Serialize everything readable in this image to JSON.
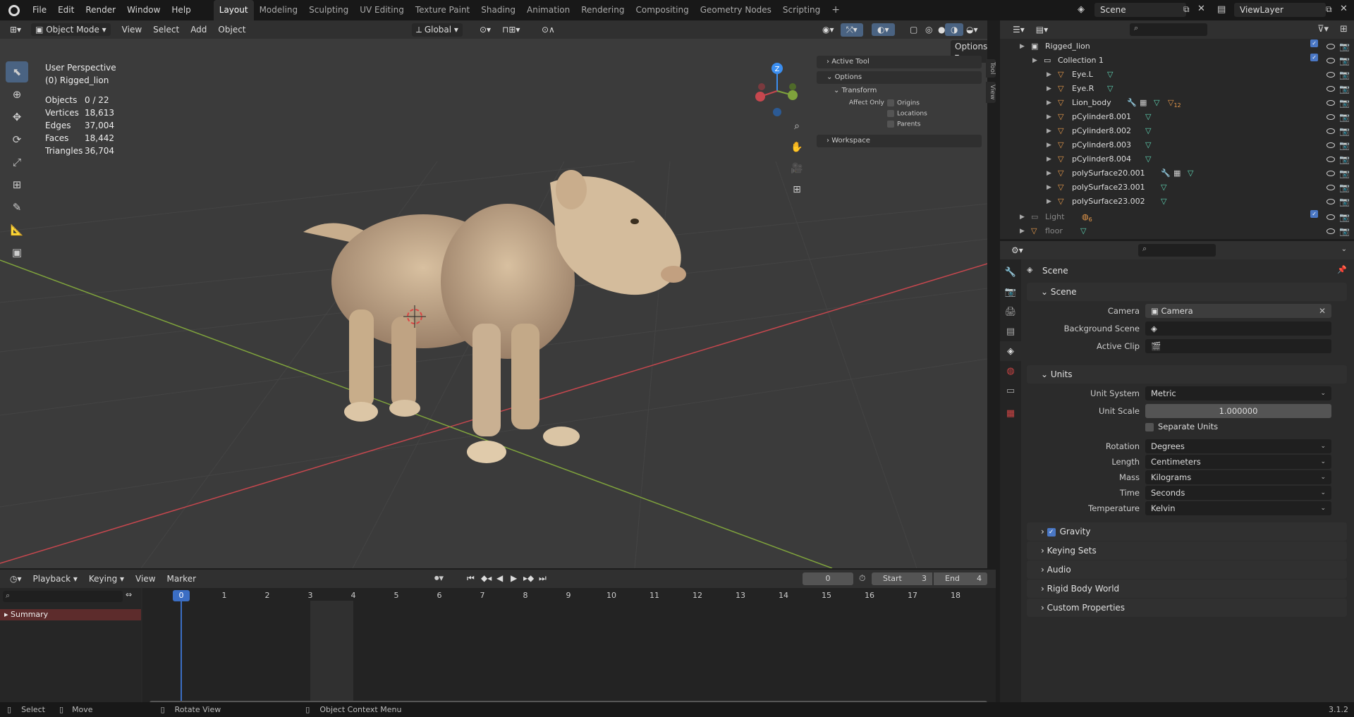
{
  "topbar": {
    "menus": [
      "File",
      "Edit",
      "Render",
      "Window",
      "Help"
    ],
    "workspaces": [
      "Layout",
      "Modeling",
      "Sculpting",
      "UV Editing",
      "Texture Paint",
      "Shading",
      "Animation",
      "Rendering",
      "Compositing",
      "Geometry Nodes",
      "Scripting"
    ],
    "active_workspace": "Layout",
    "add_tab": "+",
    "scene": "Scene",
    "view_layer": "ViewLayer"
  },
  "viewport": {
    "mode": "Object Mode",
    "menus": [
      "View",
      "Select",
      "Add",
      "Object"
    ],
    "orientation": "Global",
    "options_label": "Options",
    "view_name": "User Perspective",
    "collection_info": "(0) Rigged_lion",
    "stats": [
      {
        "k": "Objects",
        "v": "0 / 22"
      },
      {
        "k": "Vertices",
        "v": "18,613"
      },
      {
        "k": "Edges",
        "v": "37,004"
      },
      {
        "k": "Faces",
        "v": "18,442"
      },
      {
        "k": "Triangles",
        "v": "36,704"
      }
    ],
    "sidebar": {
      "active_tool": "Active Tool",
      "options": "Options",
      "transform": "Transform",
      "affect_only": "Affect Only",
      "origins": "Origins",
      "locations": "Locations",
      "parents": "Parents",
      "workspace": "Workspace"
    },
    "vtabs": [
      "Tool",
      "View"
    ],
    "gizmo_z": "Z"
  },
  "timeline": {
    "menus": [
      "Playback",
      "Keying",
      "View",
      "Marker"
    ],
    "current_frame": "0",
    "start_label": "Start",
    "start": "3",
    "end_label": "End",
    "end": "4",
    "frames": [
      "0",
      "1",
      "2",
      "3",
      "4",
      "5",
      "6",
      "7",
      "8",
      "9",
      "10",
      "11",
      "12",
      "13",
      "14",
      "15",
      "16",
      "17",
      "18"
    ],
    "summary": "Summary"
  },
  "statusbar": {
    "select": "Select",
    "move": "Move",
    "rotate": "Rotate View",
    "context": "Object Context Menu",
    "version": "3.1.2"
  },
  "outliner": {
    "root": "Rigged_lion",
    "collection": "Collection 1",
    "items": [
      "Eye.L",
      "Eye.R",
      "Lion_body",
      "pCylinder8.001",
      "pCylinder8.002",
      "pCylinder8.003",
      "pCylinder8.004",
      "polySurface20.001",
      "polySurface23.001",
      "polySurface23.002"
    ],
    "lion_body_badge": "12",
    "light": "Light",
    "light_badge": "6",
    "floor": "floor"
  },
  "properties": {
    "context": "Scene",
    "scene_panel": "Scene",
    "camera_label": "Camera",
    "camera_value": "Camera",
    "bg_scene_label": "Background Scene",
    "active_clip_label": "Active Clip",
    "units_panel": "Units",
    "unit_system_label": "Unit System",
    "unit_system": "Metric",
    "unit_scale_label": "Unit Scale",
    "unit_scale": "1.000000",
    "separate_units": "Separate Units",
    "rotation_label": "Rotation",
    "rotation": "Degrees",
    "length_label": "Length",
    "length": "Centimeters",
    "mass_label": "Mass",
    "mass": "Kilograms",
    "time_label": "Time",
    "time": "Seconds",
    "temperature_label": "Temperature",
    "temperature": "Kelvin",
    "gravity": "Gravity",
    "keying_sets": "Keying Sets",
    "audio": "Audio",
    "rigid_body_world": "Rigid Body World",
    "custom_properties": "Custom Properties"
  },
  "colors": {
    "accent": "#4a77c4",
    "x_axis": "#c6474e",
    "y_axis": "#7fa33c",
    "z_axis": "#3b8ef0"
  }
}
